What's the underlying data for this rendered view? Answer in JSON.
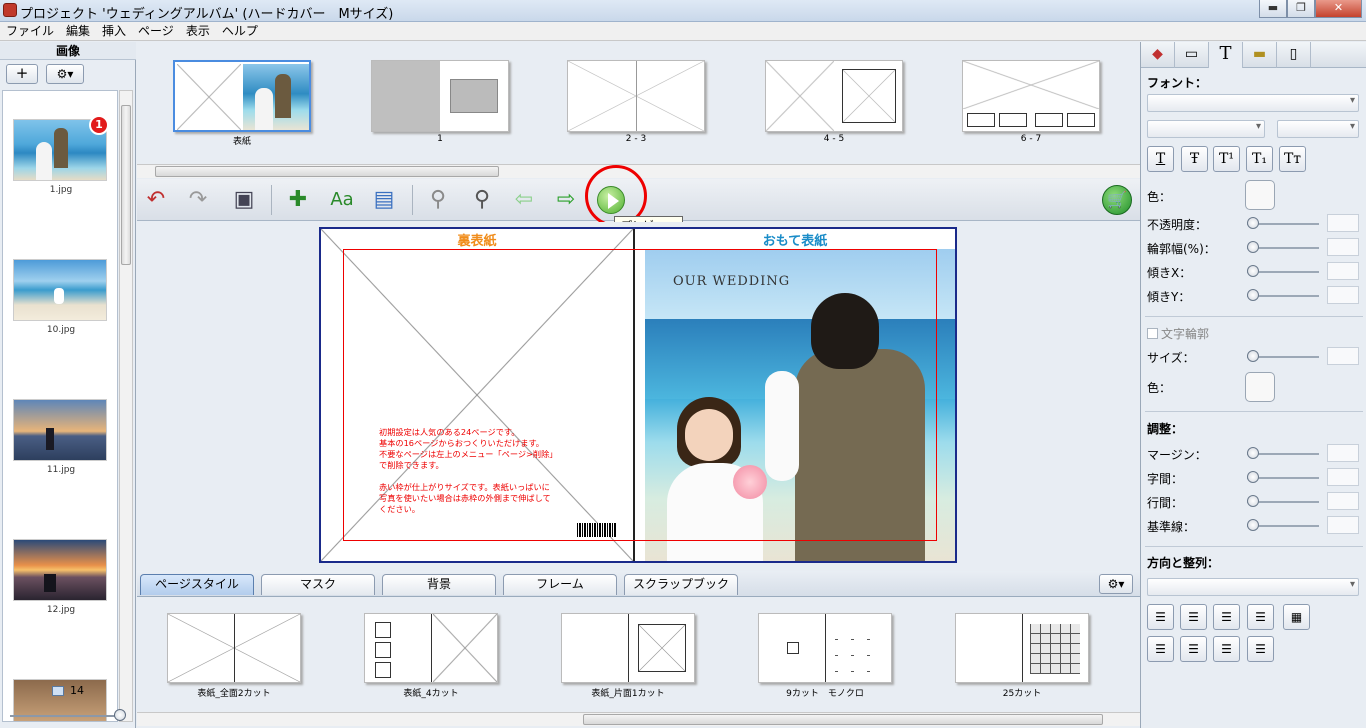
{
  "window": {
    "title": "プロジェクト 'ウェディングアルバム' (ハードカバー　Mサイズ)",
    "minimize": "▬",
    "maximize": "❐",
    "close": "✕"
  },
  "menu": [
    "ファイル",
    "編集",
    "挿入",
    "ページ",
    "表示",
    "ヘルプ"
  ],
  "left_panel": {
    "header": "画像",
    "add_label": "+",
    "gear_label": "⚙▾",
    "badge": "1",
    "photos": [
      "1.jpg",
      "10.jpg",
      "11.jpg",
      "12.jpg"
    ],
    "count": "14"
  },
  "page_strip": {
    "pages": [
      "表紙",
      "1",
      "2 - 3",
      "4 - 5",
      "6 - 7"
    ]
  },
  "toolbar": {
    "tooltip": "プレビュー"
  },
  "spread": {
    "back_title": "裏表紙",
    "front_title": "おもて表紙",
    "cover_text": "OUR  WEDDING",
    "note_lines": [
      "初期設定は人気のある24ページです。",
      "基本の16ページからおつくりいただけます。",
      "不要なページは左上のメニュー「ページ>削除」",
      "で削除できます。",
      "",
      "赤い枠が仕上がりサイズです。表紙いっぱいに",
      "写真を使いたい場合は赤枠の外側まで伸ばして",
      "ください。"
    ]
  },
  "tabs": [
    "ページスタイル",
    "マスク",
    "背景",
    "フレーム",
    "スクラップブック"
  ],
  "styles": [
    "表紙_全面2カット",
    "表紙_4カット",
    "表紙_片面1カット",
    "9カット　モノクロ",
    "25カット"
  ],
  "right_panel": {
    "font_header": "フォント：",
    "fmt_buttons": [
      "T",
      "Ŧ",
      "T¹",
      "T₁",
      "Tт"
    ],
    "color_label": "色：",
    "opacity_label": "不透明度：",
    "outline_width_label": "輪郭幅(%)：",
    "skew_x_label": "傾きX：",
    "skew_y_label": "傾きY：",
    "outline_checkbox_label": "文字輪郭",
    "size_label": "サイズ：",
    "color2_label": "色：",
    "adjust_header": "調整：",
    "margin_label": "マージン：",
    "spacing_label": "字間：",
    "line_spacing_label": "行間：",
    "baseline_label": "基準線：",
    "align_header": "方向と整列："
  },
  "colors": {
    "accent_red": "#e00000",
    "back_title": "#f08c1a",
    "front_title": "#1a8cc8"
  }
}
